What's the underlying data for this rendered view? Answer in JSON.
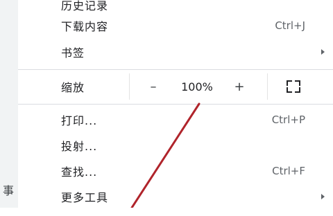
{
  "background_text": "事",
  "menu": {
    "items_top": [
      {
        "label": "历史记录",
        "shortcut": ""
      },
      {
        "label": "下载内容",
        "shortcut": "Ctrl+J"
      },
      {
        "label": "书签",
        "shortcut": "",
        "submenu": true
      }
    ],
    "zoom": {
      "label": "缩放",
      "minus": "–",
      "value": "100%",
      "plus": "+",
      "fullscreen_icon": "fullscreen-icon"
    },
    "items_bottom": [
      {
        "label": "打印...",
        "shortcut": "Ctrl+P"
      },
      {
        "label": "投射...",
        "shortcut": ""
      },
      {
        "label": "查找...",
        "shortcut": "Ctrl+F"
      },
      {
        "label": "更多工具",
        "shortcut": "",
        "submenu": true
      }
    ]
  },
  "annotation": {
    "color": "#b0242b"
  }
}
